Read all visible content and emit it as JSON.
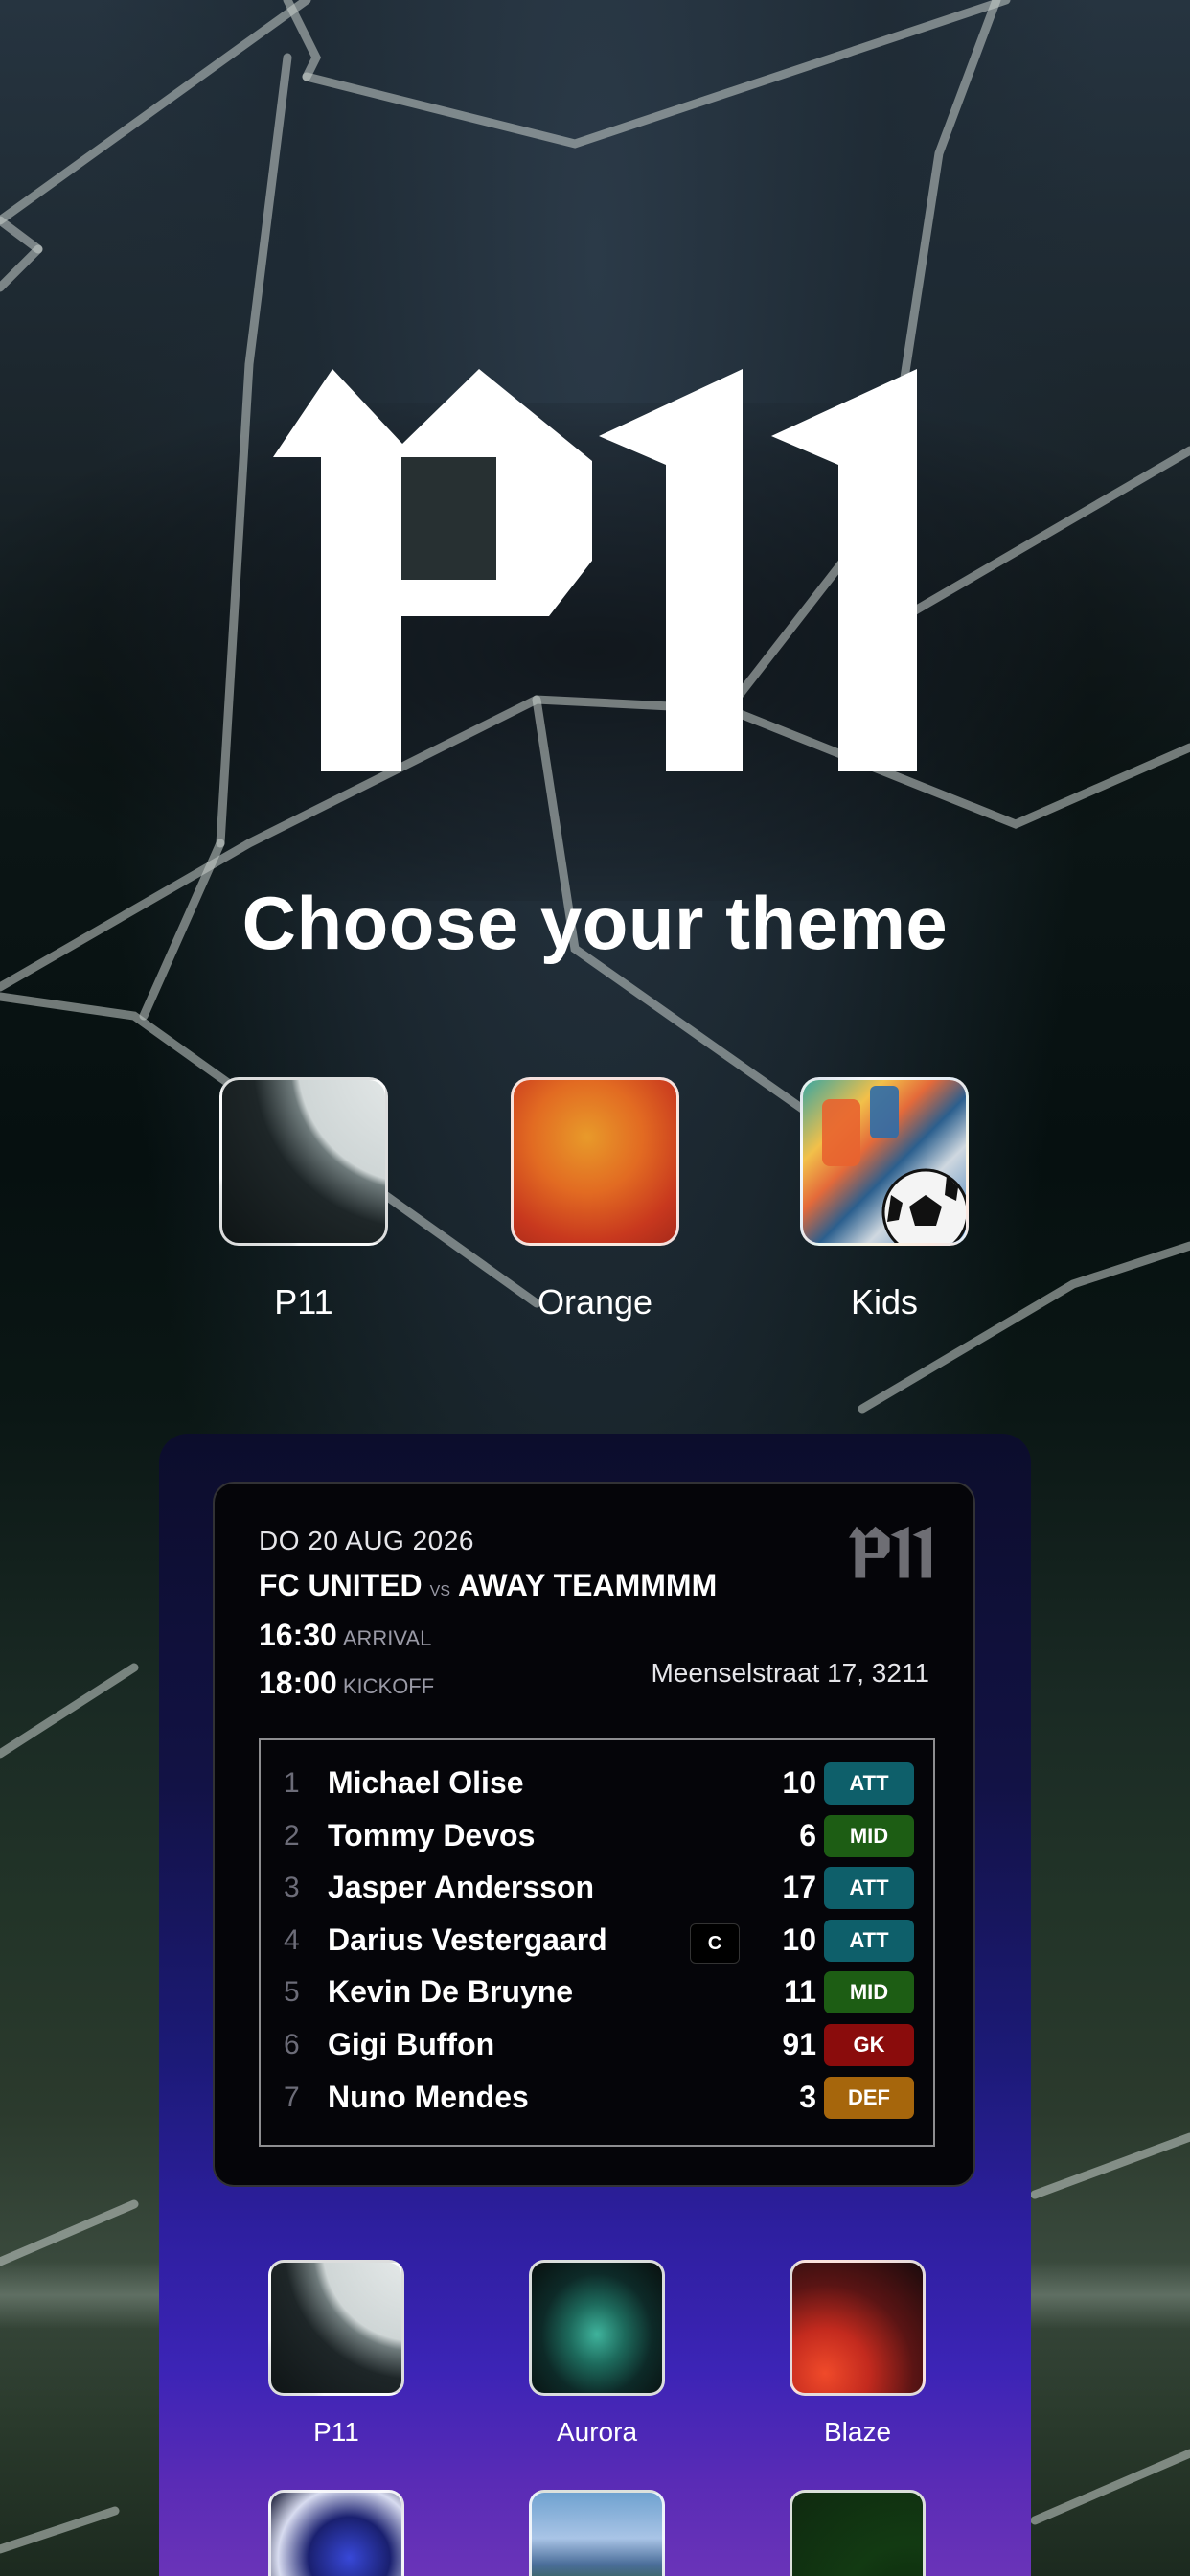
{
  "screen": {
    "title": "Choose your theme",
    "logo_text": "P11"
  },
  "themes": [
    {
      "name": "P11",
      "icon": "p11-theme-swatch",
      "selected": false
    },
    {
      "name": "Orange",
      "icon": "orange-theme-swatch",
      "selected": false
    },
    {
      "name": "Kids",
      "icon": "kids-theme-swatch",
      "selected": false
    }
  ],
  "match_card": {
    "date": "DO 20 AUG 2026",
    "home_team": "FC UNITED",
    "vs": "VS",
    "away_team": "AWAY TEAMMMM",
    "arrival_time": "16:30",
    "arrival_label": "ARRIVAL",
    "kickoff_time": "18:00",
    "kickoff_label": "KICKOFF",
    "address": "Meenselstraat 17, 3211",
    "players": [
      {
        "index": "1",
        "name": "Michael Olise",
        "captain": false,
        "number": "10",
        "position": "ATT"
      },
      {
        "index": "2",
        "name": "Tommy Devos",
        "captain": false,
        "number": "6",
        "position": "MID"
      },
      {
        "index": "3",
        "name": "Jasper Andersson",
        "captain": false,
        "number": "17",
        "position": "ATT"
      },
      {
        "index": "4",
        "name": "Darius Vestergaard",
        "captain": true,
        "captain_label": "C",
        "number": "10",
        "position": "ATT"
      },
      {
        "index": "5",
        "name": "Kevin De Bruyne",
        "captain": false,
        "number": "11",
        "position": "MID"
      },
      {
        "index": "6",
        "name": "Gigi Buffon",
        "captain": false,
        "number": "91",
        "position": "GK"
      },
      {
        "index": "7",
        "name": "Nuno Mendes",
        "captain": false,
        "number": "3",
        "position": "DEF"
      }
    ]
  },
  "position_colors": {
    "ATT": "#0e5f6a",
    "MID": "#1d5d14",
    "GK": "#8a0c0c",
    "DEF": "#a6660c"
  },
  "preview_themes": [
    {
      "name": "P11"
    },
    {
      "name": "Aurora"
    },
    {
      "name": "Blaze"
    },
    {
      "name": ""
    },
    {
      "name": ""
    },
    {
      "name": ""
    }
  ]
}
